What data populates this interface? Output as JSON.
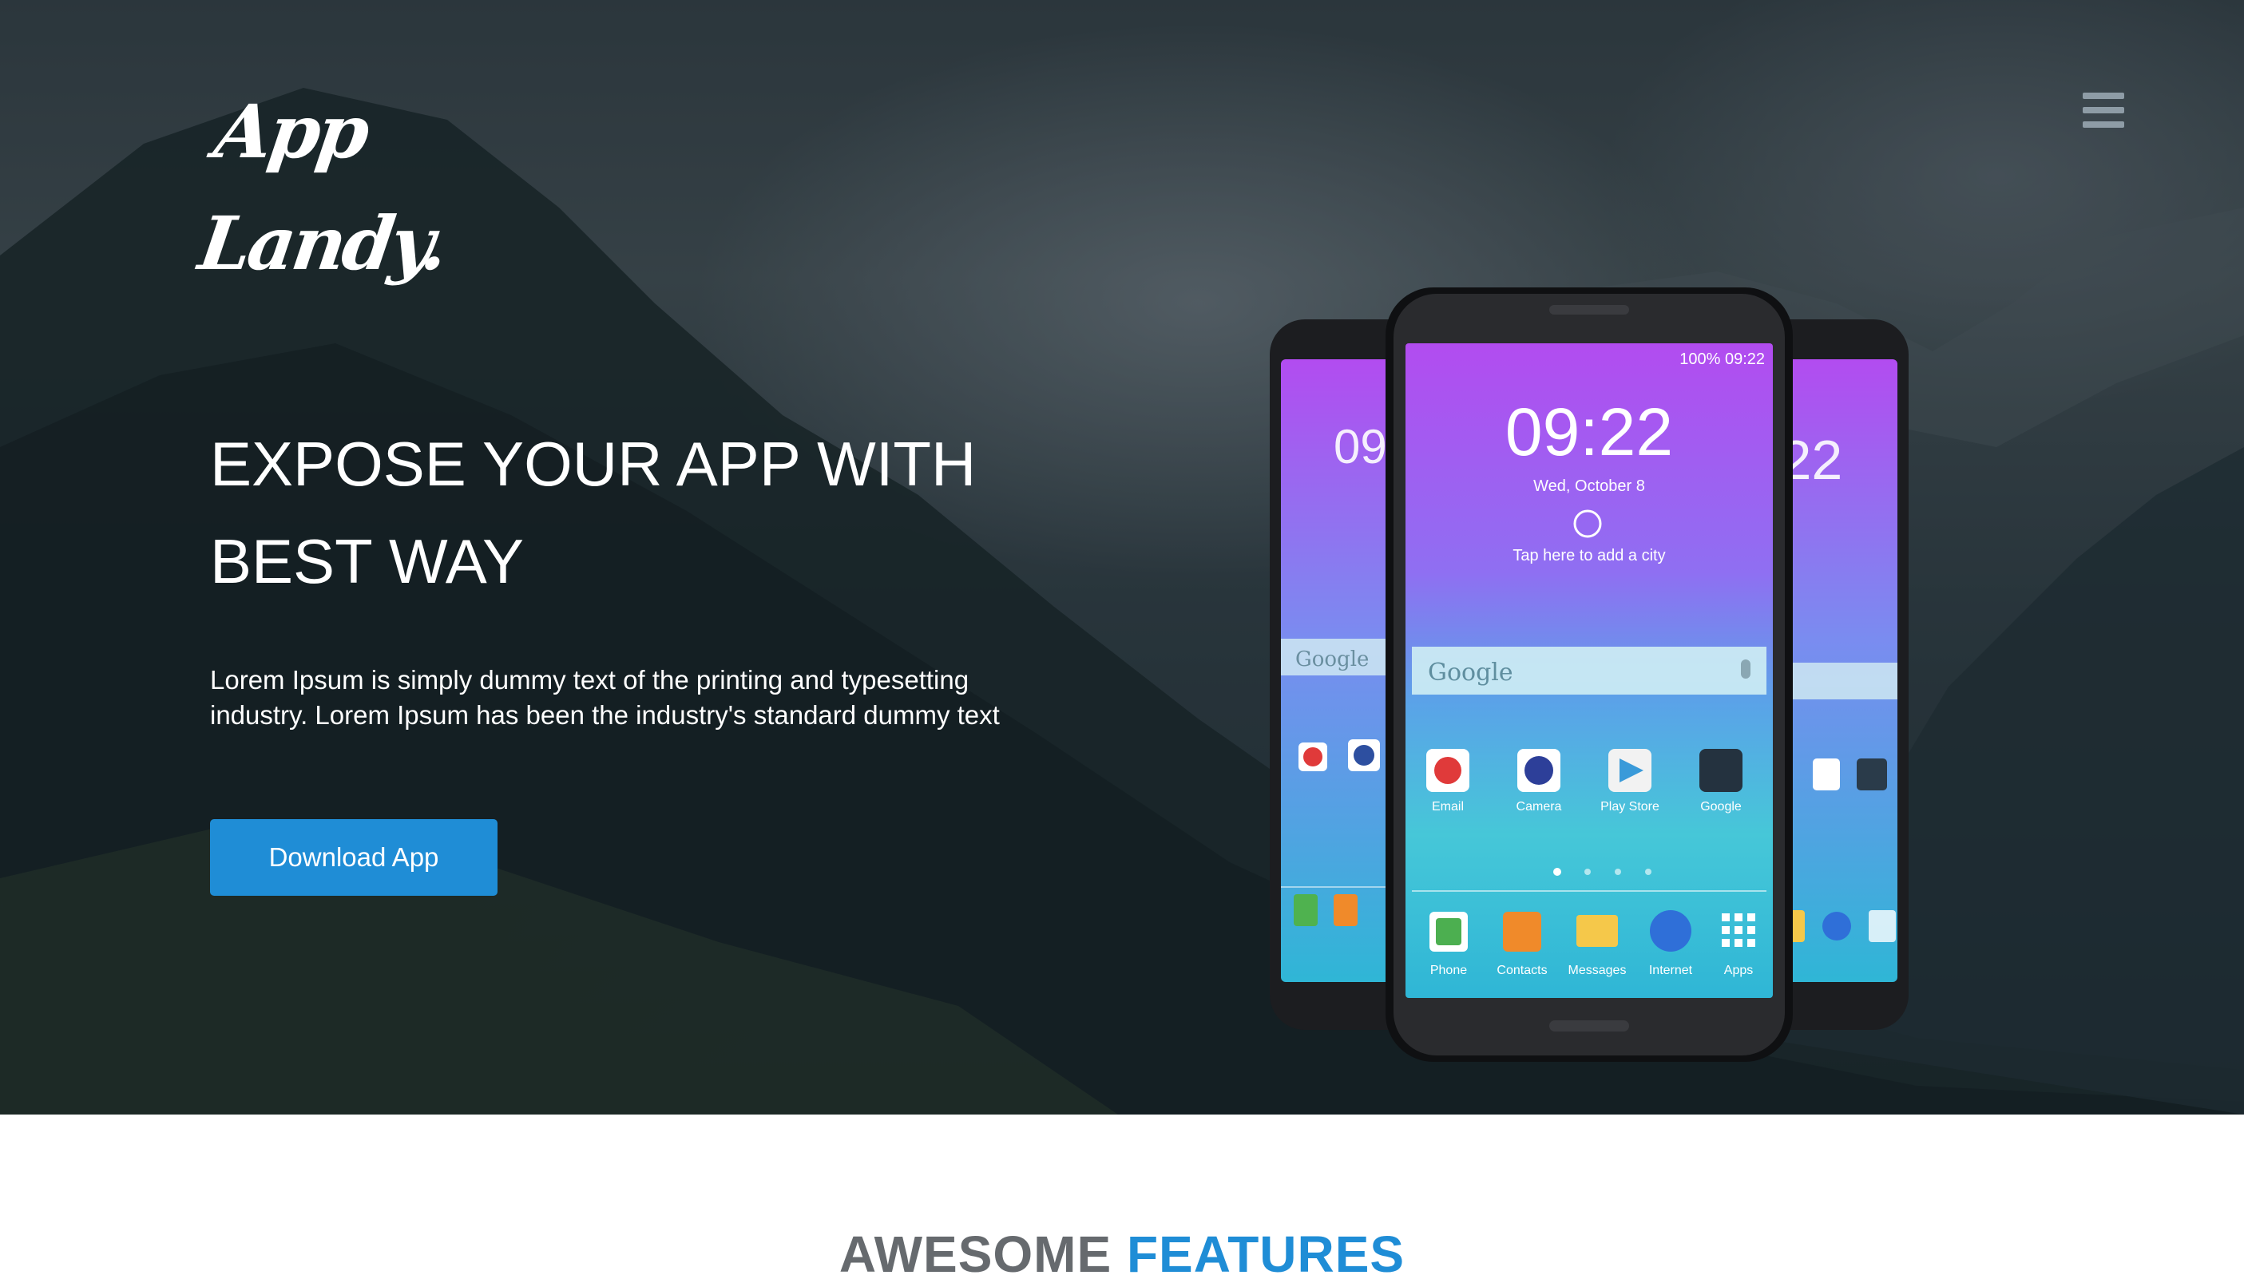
{
  "header": {
    "logo_text": "App Landy."
  },
  "hero": {
    "title_line1": "EXPOSE YOUR APP WITH",
    "title_line2": "BEST WAY",
    "description": "Lorem Ipsum is simply dummy text of the printing and typesetting industry. Lorem Ipsum has been the industry's standard dummy text",
    "button_label": "Download App"
  },
  "phone_screen": {
    "time": "09:22",
    "date": "Wed, October 8",
    "weather_hint": "Tap here to add a city",
    "search_label": "Google",
    "status_text": "100% 09:22",
    "apps_row1": [
      "Email",
      "Camera",
      "Play Store",
      "Google"
    ],
    "dock": [
      "Phone",
      "Contacts",
      "Messages",
      "Internet",
      "Apps"
    ]
  },
  "features_section": {
    "title_part1": "AWESOME",
    "title_part2": "FEATURES"
  },
  "colors": {
    "accent": "#1f8dd6",
    "title_gray": "#666a6e"
  }
}
